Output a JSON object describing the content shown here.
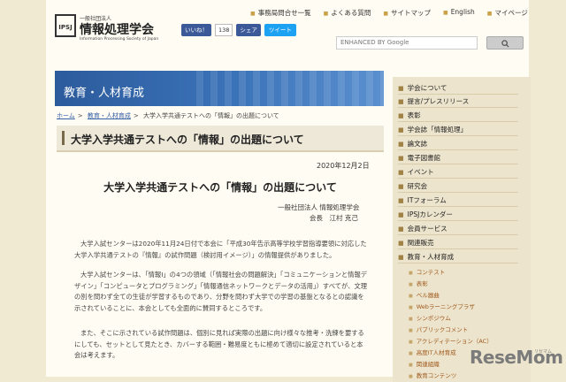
{
  "header": {
    "logo_mark": "IPSJ",
    "logo_sup": "一般社団法人",
    "logo_name": "情報処理学会",
    "logo_en": "Information Processing Society of Japan",
    "top_links": [
      "事務局問合せ一覧",
      "よくある質問",
      "サイトマップ",
      "English",
      "マイページ"
    ],
    "like_label": "いいね！",
    "like_count": "138",
    "share_label": "シェア",
    "tweet_label": "ツイート",
    "search_placeholder": "ENHANCED BY Google",
    "search_button_icon": "search-icon"
  },
  "banner": {
    "title": "教育・人材育成"
  },
  "breadcrumb": [
    "ホーム",
    "教育・人材育成",
    "大学入学共通テストへの「情報」の出題について"
  ],
  "article": {
    "section_title": "大学入学共通テストへの「情報」の出題について",
    "date": "2020年12月2日",
    "heading": "大学入学共通テストへの「情報」の出題について",
    "org": "一般社団法人 情報処理学会",
    "author": "会長　江村 克己",
    "paragraphs": [
      "大学入試センターは2020年11月24日付で本会に「平成30年告示高等学校学習指導要領に対応した大学入学共通テストの『情報』の試作問題（検討用イメージ）」の情報提供がありました。",
      "大学入試センターは、「情報Ⅰ」の4つの領域（「情報社会の問題解決」「コミュニケーションと情報デザイン」「コンピュータとプログラミング」「情報通信ネットワークとデータの活用」）すべてが、文理の別を問わず全ての生徒が学習するものであり、分野を問わず大学での学習の基盤となるとの認識を示されていることに、本会としても全面的に賛同するところです。",
      "また、そこに示されている試作問題は、個別に見れば実際の出題に向け様々な推考・洗練を要するにしても、セットとして見たとき、カバーする範囲・難易度ともに極めて適切に設定されていると本会は考えます。"
    ]
  },
  "sidebar": {
    "items": [
      "学会について",
      "提言/プレスリリース",
      "表彰",
      "学会誌「情報処理」",
      "論文誌",
      "電子図書館",
      "イベント",
      "研究会",
      "ITフォーラム",
      "IPSJカレンダー",
      "会員サービス",
      "関連販売",
      "教育・人材育成"
    ],
    "sub_items": [
      "コンテスト",
      "表彰",
      "ベル器曲",
      "Webラーニングプラザ",
      "シンポジウム",
      "パブリックコメント",
      "アクレディテーション（AC）",
      "高度IT人材育成",
      "関連組織",
      "教育コンテンツ"
    ]
  },
  "watermark": {
    "text": "ReseMom",
    "sub": "リセマム"
  }
}
